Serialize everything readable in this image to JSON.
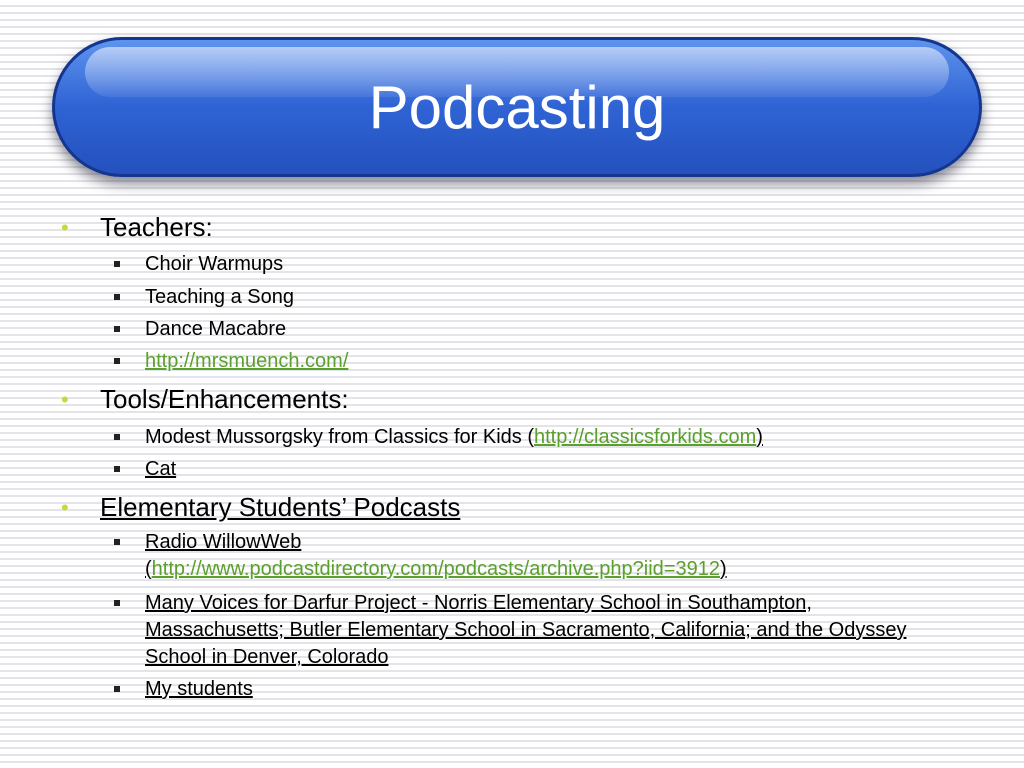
{
  "slide": {
    "title": "Podcasting",
    "sections": [
      {
        "heading": "Teachers:",
        "items": [
          {
            "text": "Choir Warmups"
          },
          {
            "text": "Teaching a Song"
          },
          {
            "text": "Dance Macabre"
          },
          {
            "link": "http://mrsmuench.com/"
          }
        ]
      },
      {
        "heading": "Tools/Enhancements:",
        "items": [
          {
            "text": "Modest Mussorgsky from Classics for Kids (",
            "link": "http://classicsforkids.com",
            "after": ")"
          },
          {
            "text": "Cat"
          }
        ]
      },
      {
        "heading": "Elementary Students’ Podcasts",
        "items": [
          {
            "text": "Radio WillowWeb",
            "line2_before": "(",
            "link": "http://www.podcastdirectory.com/podcasts/archive.php?iid=3912",
            "after": ")"
          },
          {
            "text": "Many Voices for Darfur Project - Norris Elementary School in Southampton, Massachusetts; Butler Elementary School in Sacramento, California; and the Odyssey School in Denver, Colorado"
          },
          {
            "text": "My students"
          }
        ]
      }
    ]
  }
}
